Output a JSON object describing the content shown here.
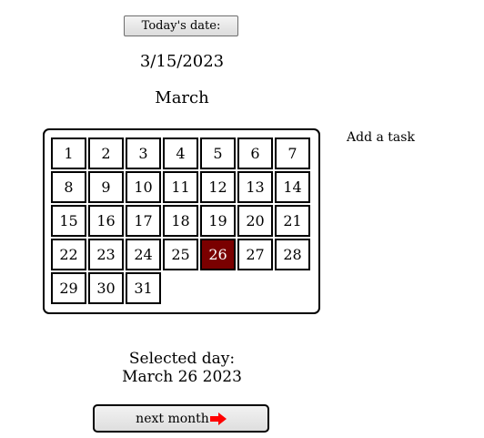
{
  "header": {
    "today_button_label": "Today's date:",
    "today_date": "3/15/2023",
    "month_name": "March"
  },
  "calendar": {
    "days": [
      "1",
      "2",
      "3",
      "4",
      "5",
      "6",
      "7",
      "8",
      "9",
      "10",
      "11",
      "12",
      "13",
      "14",
      "15",
      "16",
      "17",
      "18",
      "19",
      "20",
      "21",
      "22",
      "23",
      "24",
      "25",
      "26",
      "27",
      "28",
      "29",
      "30",
      "31"
    ],
    "selected_day": "26",
    "selected_color": "#7a0000"
  },
  "add_task_label": "Add a task",
  "selection": {
    "label": "Selected day:",
    "value": "March 26 2023"
  },
  "next_button": {
    "label": "next month",
    "icon": "right-arrow-icon",
    "icon_color": "#ff0000"
  }
}
